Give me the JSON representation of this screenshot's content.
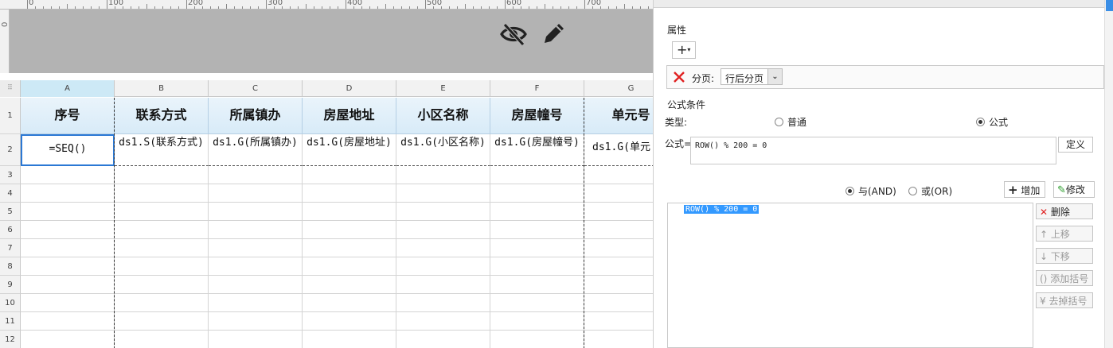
{
  "ruler": {
    "labels": [
      "0",
      "100",
      "200",
      "300",
      "400",
      "500",
      "600",
      "700"
    ],
    "vlabel": "0"
  },
  "canvas_icons": {
    "hide": "eye-slash-icon",
    "edit": "pencil-icon"
  },
  "sheet": {
    "corner": "⠿",
    "columns": [
      "A",
      "B",
      "C",
      "D",
      "E",
      "F",
      "G"
    ],
    "rows": [
      "1",
      "2",
      "3",
      "4",
      "5",
      "6",
      "7",
      "8",
      "9",
      "10",
      "11",
      "12"
    ],
    "headers": [
      "序号",
      "联系方式",
      "所属镇办",
      "房屋地址",
      "小区名称",
      "房屋幢号",
      "单元号"
    ],
    "exprs": [
      "=SEQ()",
      "ds1.S(联系方式)",
      "ds1.G(所属镇办)",
      "ds1.G(房屋地址)",
      "ds1.G(小区名称)",
      "ds1.G(房屋幢号)",
      "ds1.G(单元"
    ]
  },
  "panel": {
    "attr_title": "属性",
    "add_btn": "+",
    "page_label": "分页:",
    "page_value": "行后分页",
    "cond_title": "公式条件",
    "type_label": "类型:",
    "type_normal": "普通",
    "type_formula": "公式",
    "formula_label": "公式=",
    "formula_value": "ROW() % 200 = 0",
    "define_btn": "定义",
    "and_label": "与(AND)",
    "or_label": "或(OR)",
    "add_label": "增加",
    "modify_label": "修改",
    "list_item": "ROW() % 200 = 0",
    "delete_label": "删除",
    "up_label": "上移",
    "down_label": "下移",
    "add_paren_label": "添加括号",
    "remove_paren_label": "去掉括号"
  }
}
